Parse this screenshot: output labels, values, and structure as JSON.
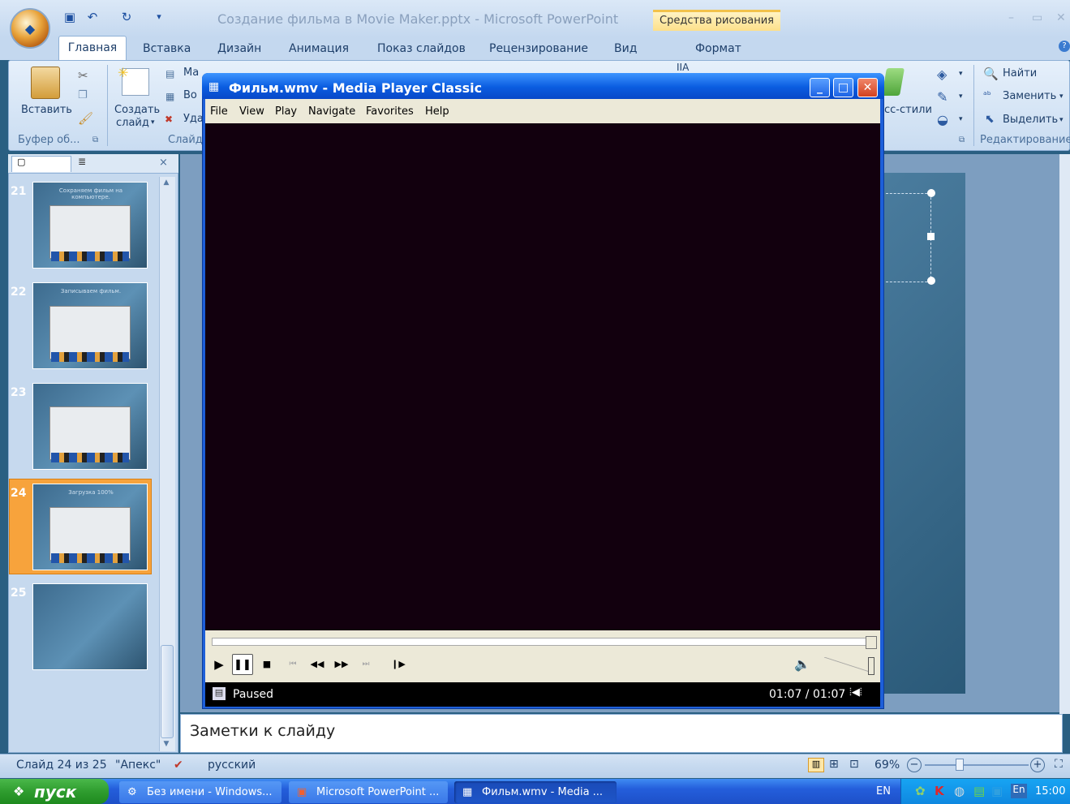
{
  "ppt": {
    "window_title": "Создание фильма в Movie Maker.pptx - Microsoft PowerPoint",
    "context_group": "Средства рисования",
    "tabs": [
      "Главная",
      "Вставка",
      "Дизайн",
      "Анимация",
      "Показ слайдов",
      "Рецензирование",
      "Вид",
      "Формат"
    ],
    "ribbon": {
      "paste": "Вставить",
      "new_slide_1": "Создать",
      "new_slide_2": "слайд",
      "layout_partial": "Ма",
      "reset_partial": "Во",
      "delete_partial": "Уда",
      "clipboard_group": "Буфер об...",
      "slides_group": "Слайд",
      "styles_partial": "сс-стили",
      "find": "Найти",
      "replace": "Заменить",
      "select": "Выделить",
      "editing_group": "Редактирование",
      "partial_top": "IIA"
    },
    "slides": [
      {
        "num": "21",
        "caption": "Сохраняем фильм на компьютере."
      },
      {
        "num": "22",
        "caption": "Записываем фильм."
      },
      {
        "num": "23",
        "caption": ""
      },
      {
        "num": "24",
        "caption": "Загрузка 100%"
      },
      {
        "num": "25",
        "caption": ""
      }
    ],
    "notes_placeholder": "Заметки к слайду",
    "status": {
      "slide_info": "Слайд 24 из 25",
      "theme": "\"Апекс\"",
      "language": "русский",
      "zoom": "69%"
    }
  },
  "mpc": {
    "title": "Фильм.wmv - Media Player Classic",
    "menu": [
      "File",
      "View",
      "Play",
      "Navigate",
      "Favorites",
      "Help"
    ],
    "state": "Paused",
    "time": "01:07 / 01:07"
  },
  "taskbar": {
    "start": "пуск",
    "tasks": [
      "Без имени - Windows...",
      "Microsoft PowerPoint ...",
      "Фильм.wmv - Media ..."
    ],
    "lang1": "EN",
    "lang2": "En",
    "clock": "15:00"
  },
  "colors": {
    "video_bg": "#12000e",
    "selected_thumb": "#f7a33c",
    "xp_blue": "#245edb"
  }
}
